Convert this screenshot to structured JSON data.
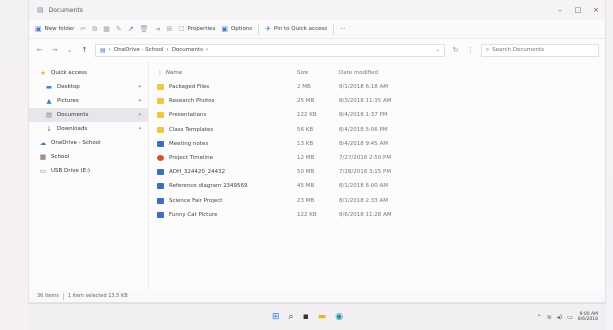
{
  "window": {
    "title": "Documents",
    "controls": {
      "minimize": "–",
      "maximize": "□",
      "close": "×"
    }
  },
  "toolbar": {
    "new_folder": "New folder",
    "properties": "Properties",
    "options": "Options",
    "pin": "Pin to Quick access",
    "more": "···"
  },
  "address": {
    "path": [
      "OneDrive - School",
      "Documents"
    ],
    "search_placeholder": "Search Documents"
  },
  "sidebar": {
    "items": [
      {
        "label": "Quick access",
        "icon": "star-icon",
        "color": "#f2b321",
        "indent": false,
        "pinned": false,
        "selected": false
      },
      {
        "label": "Desktop",
        "icon": "desktop-icon",
        "color": "#3a78d4",
        "indent": true,
        "pinned": true,
        "selected": false
      },
      {
        "label": "Pictures",
        "icon": "pictures-icon",
        "color": "#3a78d4",
        "indent": true,
        "pinned": true,
        "selected": false
      },
      {
        "label": "Documents",
        "icon": "documents-icon",
        "color": "#7a8594",
        "indent": true,
        "pinned": true,
        "selected": true
      },
      {
        "label": "Downloads",
        "icon": "download-icon",
        "color": "#3a78d4",
        "indent": true,
        "pinned": true,
        "selected": false
      },
      {
        "label": "OneDrive - School",
        "icon": "cloud-icon",
        "color": "#2f7fd6",
        "indent": false,
        "pinned": false,
        "selected": false
      },
      {
        "label": "School",
        "icon": "building-icon",
        "color": "#555555",
        "indent": false,
        "pinned": false,
        "selected": false
      },
      {
        "label": "USB Drive (E:)",
        "icon": "usb-drive-icon",
        "color": "#777777",
        "indent": false,
        "pinned": false,
        "selected": false
      }
    ]
  },
  "columns": {
    "name": "Name",
    "size": "Size",
    "date": "Date modified"
  },
  "files": [
    {
      "name": "Packaged Files",
      "size": "2 MB",
      "date": "8/1/2018 6:18 AM",
      "type": "folder"
    },
    {
      "name": "Research Photos",
      "size": "25 MB",
      "date": "8/3/2018 11:35 AM",
      "type": "folder"
    },
    {
      "name": "Presentations",
      "size": "122 KB",
      "date": "8/4/2018 1:37 PM",
      "type": "folder"
    },
    {
      "name": "Class Templates",
      "size": "56 KB",
      "date": "8/4/2018 5:06 PM",
      "type": "folder"
    },
    {
      "name": "Meeting notes",
      "size": "13 KB",
      "date": "8/4/2018 9:45 AM",
      "type": "doc"
    },
    {
      "name": "Project Timeline",
      "size": "12 MB",
      "date": "7/27/2018 2:50 PM",
      "type": "ppt"
    },
    {
      "name": "ADH_324420_24432",
      "size": "50 MB",
      "date": "7/28/2018 3:15 PM",
      "type": "pdf"
    },
    {
      "name": "Reference diagram 2349569",
      "size": "45 MB",
      "date": "8/1/2018 6:00 AM",
      "type": "pdf"
    },
    {
      "name": "Science Fair Project",
      "size": "23 MB",
      "date": "8/1/2018 2:33 AM",
      "type": "pdf"
    },
    {
      "name": "Funny Cat Picture",
      "size": "122 KB",
      "date": "8/6/2018 11:28 AM",
      "type": "pdf"
    }
  ],
  "status": {
    "items": "36 items",
    "selected": "1 item selected 13.5 KB"
  },
  "taskbar": {
    "clock_time": "9:00 AM",
    "clock_date": "8/6/2018"
  }
}
